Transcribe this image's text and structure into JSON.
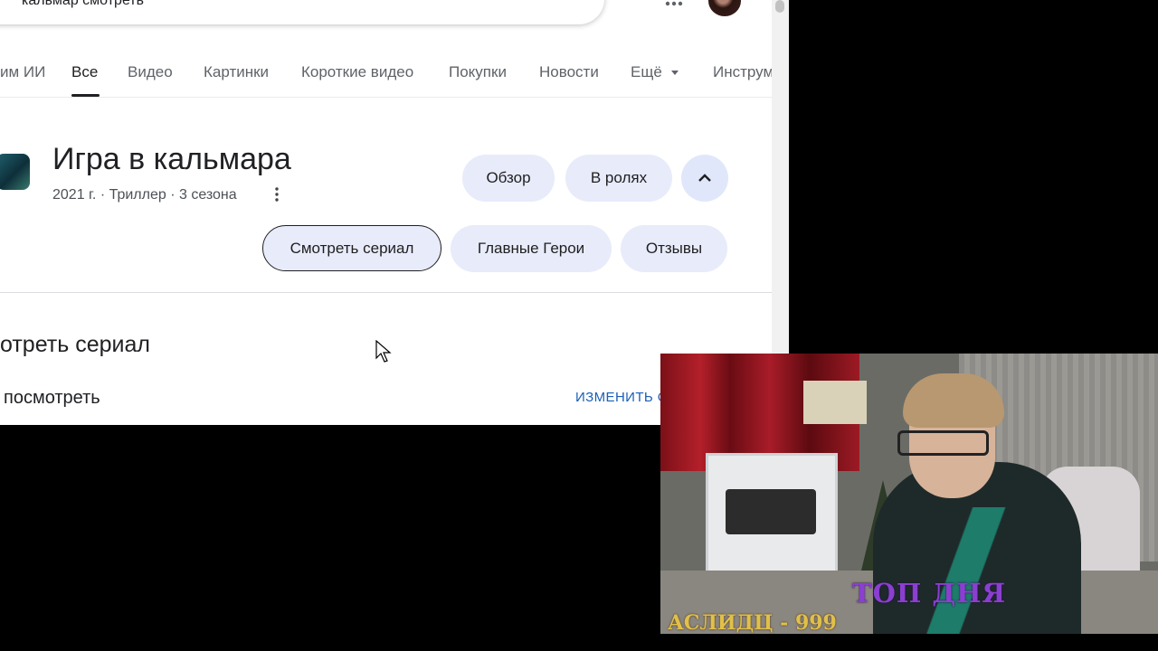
{
  "search": {
    "query": "кальмар смотреть"
  },
  "tabs": [
    {
      "label": "им ИИ"
    },
    {
      "label": "Все"
    },
    {
      "label": "Видео"
    },
    {
      "label": "Картинки"
    },
    {
      "label": "Короткие видео"
    },
    {
      "label": "Покупки"
    },
    {
      "label": "Новости"
    },
    {
      "label": "Ещё"
    },
    {
      "label": "Инструм"
    }
  ],
  "entity": {
    "title": "Игра в кальмара",
    "subtitle": "2021 г. · Триллер · 3 сезона",
    "chips_row1": [
      "Обзор",
      "В ролях"
    ],
    "chips_row2": [
      "Смотреть сериал",
      "Главные Герои",
      "Отзывы"
    ]
  },
  "watch_section": {
    "heading": "отреть сериал",
    "where_label": "посмотреть",
    "change_services": "ИЗМЕНИТЬ СЕРВИСЫ"
  },
  "webcam_overlay": {
    "top_label": "ТОП ДНЯ",
    "leader_text": "АСЛИДЦ - 999"
  },
  "colors": {
    "chip_bg": "#e8ebfa",
    "link": "#1a5fb4",
    "overlay_top": "#8a3fd1",
    "overlay_leader": "#e0c04a"
  }
}
